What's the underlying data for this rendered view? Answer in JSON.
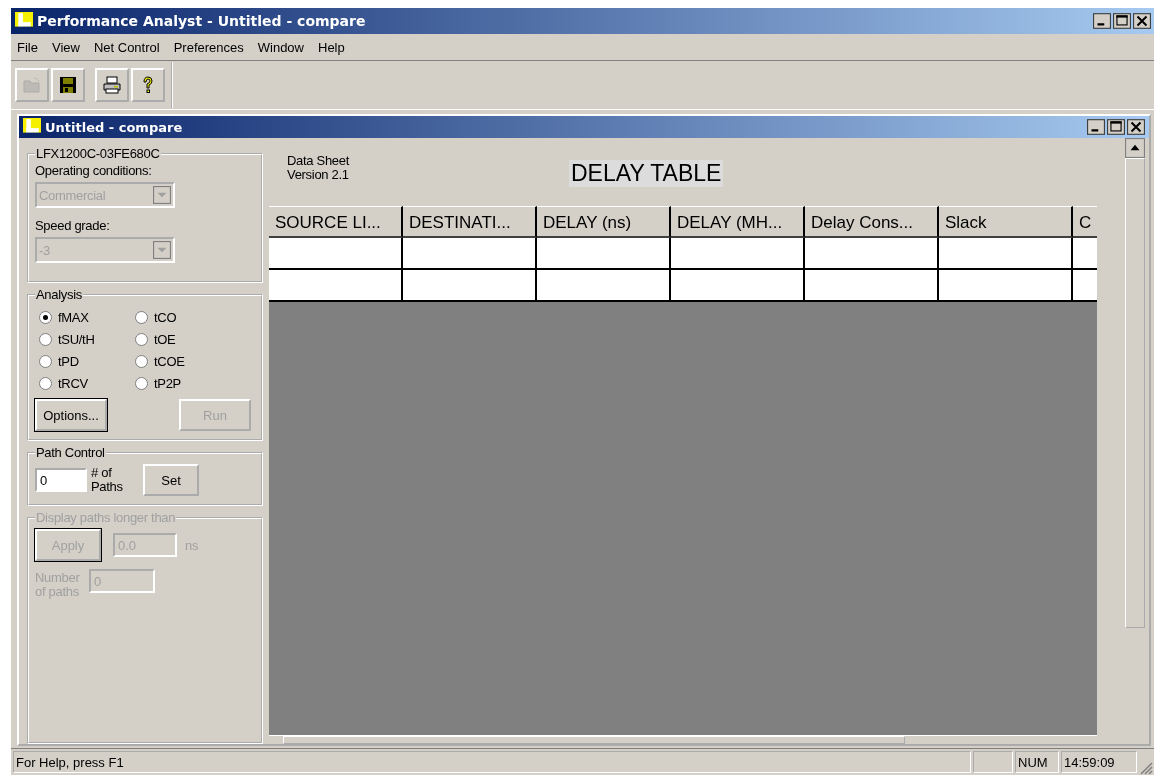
{
  "window": {
    "title": "Performance Analyst - Untitled - compare"
  },
  "menu": [
    "File",
    "View",
    "Net Control",
    "Preferences",
    "Window",
    "Help"
  ],
  "toolbar": [
    {
      "kind": "open",
      "disabled": true
    },
    {
      "kind": "save",
      "disabled": false
    },
    {
      "kind": "print",
      "disabled": false
    },
    {
      "kind": "help",
      "disabled": false
    }
  ],
  "child_window": {
    "title": "Untitled - compare"
  },
  "device": {
    "title": "LFX1200C-03FE680C",
    "operating_label": "Operating conditions:",
    "operating_value": "Commercial",
    "operating_disabled": true,
    "speed_label": "Speed grade:",
    "speed_value": "-3",
    "speed_disabled": true
  },
  "analysis": {
    "title": "Analysis",
    "options": [
      {
        "label": "fMAX",
        "selected": true
      },
      {
        "label": "tCO",
        "selected": false
      },
      {
        "label": "tSU/tH",
        "selected": false
      },
      {
        "label": "tOE",
        "selected": false
      },
      {
        "label": "tPD",
        "selected": false
      },
      {
        "label": "tCOE",
        "selected": false
      },
      {
        "label": "tRCV",
        "selected": false
      },
      {
        "label": "tP2P",
        "selected": false
      }
    ],
    "buttons": [
      {
        "label": "Options...",
        "disabled": false
      },
      {
        "label": "Run",
        "disabled": true
      }
    ]
  },
  "path_control": {
    "title": "Path Control",
    "value": "0",
    "label": "# of Paths",
    "button": "Set"
  },
  "display_paths": {
    "title": "Display paths longer than",
    "disabled": true,
    "button": "Apply",
    "value": "0.0",
    "unit": "ns",
    "count_label": "Number of paths",
    "count_value": "0"
  },
  "data_sheet": [
    "Data Sheet",
    "Version 2.1"
  ],
  "table_title": "DELAY TABLE",
  "table": {
    "columns": [
      "SOURCE LI...",
      "DESTINATI...",
      "DELAY (ns)",
      "DELAY (MH...",
      "Delay Cons...",
      "Slack",
      "C"
    ]
  },
  "status_bar": [
    "For Help, press F1",
    "NUM",
    "14:59:09"
  ]
}
